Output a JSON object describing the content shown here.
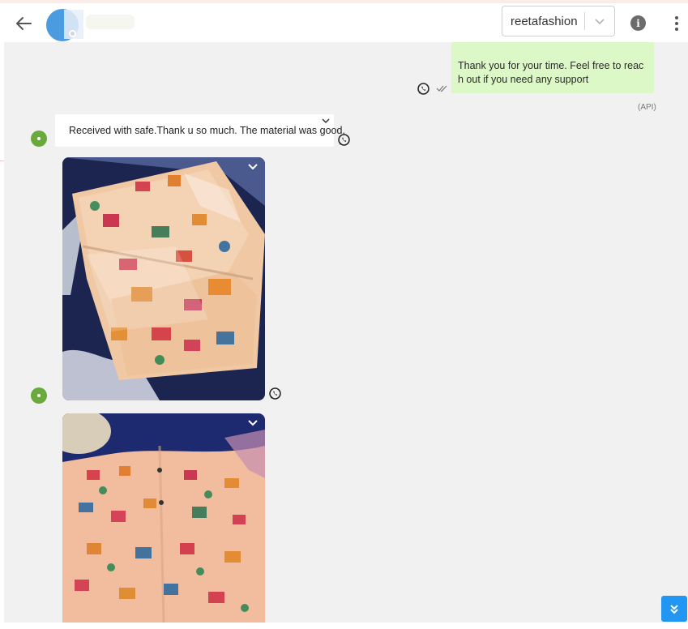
{
  "header": {
    "back_icon": "arrow-left-icon",
    "account_select": {
      "selected": "reetafashion"
    },
    "info_icon_glyph": "i",
    "menu_icon": "kebab-menu-icon"
  },
  "messages": {
    "outgoing": {
      "text": "Thank you for your time. Feel free to reach out if you need any support",
      "source_label": "(API)",
      "channel_icon": "whatsapp-icon",
      "status_icon": "double-check-icon"
    },
    "incoming_text": {
      "text": "Received with safe.Thank u so much. The material was good.",
      "channel_icon": "whatsapp-icon"
    },
    "incoming_images": [
      {
        "description_icon": "image-icon",
        "channel_icon": "whatsapp-icon"
      },
      {
        "description_icon": "image-icon"
      }
    ]
  },
  "colors": {
    "outgoing_bubble": "#dcf8c6",
    "incoming_bubble": "#ffffff",
    "chat_background": "#f1f1f1",
    "online_dot": "#6aaa3d",
    "scroll_button": "#2196f3",
    "avatar": "#4a9be0"
  },
  "controls": {
    "scroll_bottom_icon": "double-chevron-down-icon"
  }
}
